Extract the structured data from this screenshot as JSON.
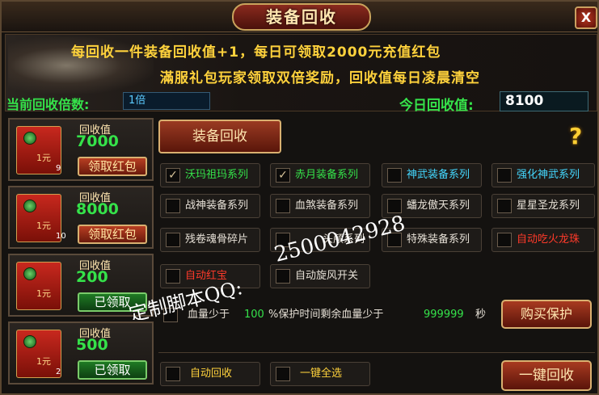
{
  "window": {
    "title": "装备回收",
    "close_label": "X"
  },
  "banner": {
    "line1": "每回收一件装备回收值+1，每日可领取2000元充值红包",
    "line2": "滿服礼包玩家领取双倍奖励，回收值每日凌晨清空"
  },
  "multiplier": {
    "label": "当前回收倍数:",
    "value": "1倍"
  },
  "today": {
    "label": "今日回收值:",
    "value": "8100"
  },
  "cards": [
    {
      "label": "回收值",
      "value": "7000",
      "yuan": "1元",
      "count": "9",
      "button": "领取红包",
      "state": "claim"
    },
    {
      "label": "回收值",
      "value": "8000",
      "yuan": "1元",
      "count": "10",
      "button": "领取红包",
      "state": "claim"
    },
    {
      "label": "回收值",
      "value": "200",
      "yuan": "1元",
      "count": "",
      "button": "已领取",
      "state": "claimed"
    },
    {
      "label": "回收值",
      "value": "500",
      "yuan": "1元",
      "count": "2",
      "button": "已领取",
      "state": "claimed"
    }
  ],
  "main_tab": "装备回收",
  "help_icon": "?",
  "options": [
    {
      "label": "沃玛祖玛系列",
      "checked": true,
      "color": "#35e24a"
    },
    {
      "label": "赤月装备系列",
      "checked": true,
      "color": "#35e24a"
    },
    {
      "label": "神武装备系列",
      "checked": false,
      "color": "#44d8ff"
    },
    {
      "label": "强化神武系列",
      "checked": false,
      "color": "#44d8ff"
    },
    {
      "label": "战神装备系列",
      "checked": false,
      "color": "#e6e0d6"
    },
    {
      "label": "血煞装备系列",
      "checked": false,
      "color": "#e6e0d6"
    },
    {
      "label": "蟠龙傲天系列",
      "checked": false,
      "color": "#e6e0d6"
    },
    {
      "label": "星星圣龙系列",
      "checked": false,
      "color": "#e6e0d6"
    },
    {
      "label": "残卷魂骨碎片",
      "checked": false,
      "color": "#e6e0d6"
    },
    {
      "label": "头颅系列",
      "checked": false,
      "color": "#e6e0d6"
    },
    {
      "label": "特殊装备系列",
      "checked": false,
      "color": "#e6e0d6"
    },
    {
      "label": "自动吃火龙珠",
      "checked": false,
      "color": "#ff3a2a"
    },
    {
      "label": "自动红宝",
      "checked": false,
      "color": "#ff3a2a"
    },
    {
      "label": "自动旋风开关",
      "checked": false,
      "color": "#e6e0d6"
    }
  ],
  "protection": {
    "prefix": "血量少于",
    "percent": "100",
    "mid": "%保护时间剩余血量少于",
    "hp": "999999",
    "suffix": "秒",
    "buy_label": "购买保护"
  },
  "bottom": {
    "auto_recycle": "自动回收",
    "select_all": "一键全选",
    "one_click": "一键回收"
  },
  "watermark": {
    "line1": "2500042928",
    "line2": "定制脚本QQ:"
  }
}
